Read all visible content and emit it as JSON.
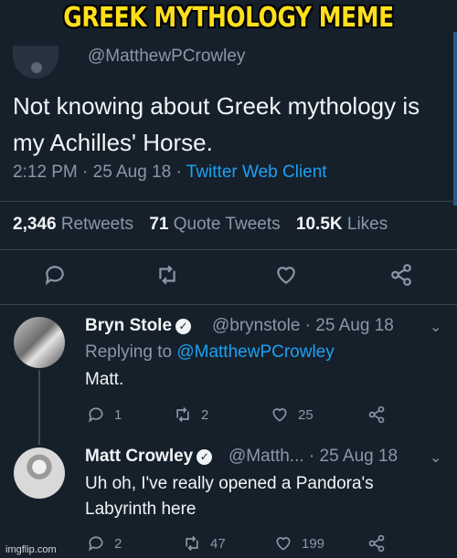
{
  "meme_title": "GREEK MYTHOLOGY MEME",
  "original_tweet": {
    "handle": "@MatthewPCrowley",
    "text": "Not knowing about Greek mythology is my Achilles' Horse.",
    "time": "2:12 PM · 25 Aug 18 ·",
    "client": "Twitter Web Client",
    "retweets_count": "2,346",
    "retweets_label": "Retweets",
    "quote_count": "71",
    "quote_label": "Quote Tweets",
    "likes_count": "10.5K",
    "likes_label": "Likes",
    "actions": [
      "reply-icon",
      "retweet-icon",
      "heart-icon",
      "share-icon"
    ]
  },
  "replies": [
    {
      "name": "Bryn Stole",
      "handle": "@brynstole · 25 Aug 18",
      "replying_prefix": "Replying to",
      "replying_mention": "@MatthewPCrowley",
      "text": "Matt.",
      "reply_count": "1",
      "retweet_count": "2",
      "like_count": "25"
    },
    {
      "name": "Matt Crowley",
      "handle": "@Matth... · 25 Aug 18",
      "text": "Uh oh, I've really opened a Pandora's Labyrinth here",
      "reply_count": "2",
      "retweet_count": "47",
      "like_count": "199"
    }
  ],
  "watermark": "imgflip.com",
  "colors": {
    "background": "#15202b",
    "link": "#1da1f2",
    "muted": "#8899a6",
    "meme_title": "#ffdf1c"
  }
}
